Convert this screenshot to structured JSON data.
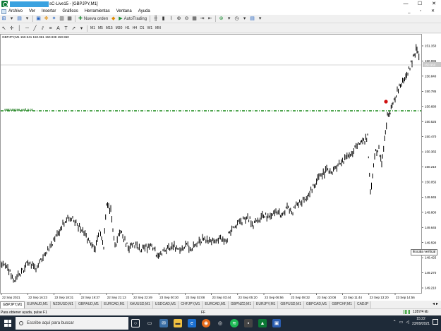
{
  "window": {
    "title": "sC-Live15 - [GBPJPY,M1]",
    "controls": [
      "—",
      "☐",
      "✕"
    ]
  },
  "menu": {
    "items": [
      "Archivo",
      "Ver",
      "Insertar",
      "Gráficos",
      "Herramientas",
      "Ventana",
      "Ayuda"
    ],
    "mdi_controls": "_ ▫ ✕"
  },
  "toolbar": {
    "new_order_label": "Nueva orden",
    "autotrading_label": "AutoTrading"
  },
  "timeframes": [
    "M1",
    "M5",
    "M15",
    "M30",
    "H1",
    "H4",
    "D1",
    "W1",
    "MN"
  ],
  "chart": {
    "info": "GBPJPY,M1 150.941 150.961 150.938 150.960",
    "order_label": "#88749256 sell 0.01",
    "current_price": "150.960",
    "tooltip": "Escala vertical",
    "price_ticks": [
      "151.150",
      "150.995",
      "150.840",
      "150.785",
      "150.680",
      "150.525",
      "150.470",
      "150.365",
      "150.210",
      "150.055",
      "149.945",
      "149.800",
      "149.645",
      "149.590",
      "149.425",
      "149.270",
      "149.210"
    ],
    "time_ticks": [
      "22 Sep 2021",
      "22 Sep 16:23",
      "22 Sep 18:31",
      "22 Sep 19:37",
      "22 Sep 21:13",
      "22 Sep 22:49",
      "23 Sep 00:30",
      "23 Sep 02:08",
      "23 Sep 03:44",
      "23 Sep 05:20",
      "23 Sep 06:56",
      "23 Sep 08:32",
      "23 Sep 10:08",
      "23 Sep 11:44",
      "23 Sep 13:20",
      "23 Sep 14:56"
    ],
    "colors": {
      "candles": "#000000",
      "order_line": "#1a8a1a",
      "marker": "#d01010"
    }
  },
  "symbol_tabs": [
    "GBPJPY,M1",
    "EURAUD,M1",
    "NZDUSD,M1",
    "GBPAUD,M1",
    "EURCAD,M1",
    "XAUUSD,M1",
    "USDCAD,M1",
    "CHFJPY,M1",
    "EURCAD,M1",
    "GBPNZD,M1",
    "EURJPY,M1",
    "GBPUSD,M1",
    "GBPCAD,M1",
    "GBPCHF,M1",
    "CADJP"
  ],
  "status": {
    "help": "Para obtener ayuda, pulse F1",
    "default": "FF",
    "traffic": "1287/4 kb"
  },
  "taskbar": {
    "search_placeholder": "Escribe aquí para buscar",
    "time": "15:22",
    "date": "23/09/2021"
  }
}
